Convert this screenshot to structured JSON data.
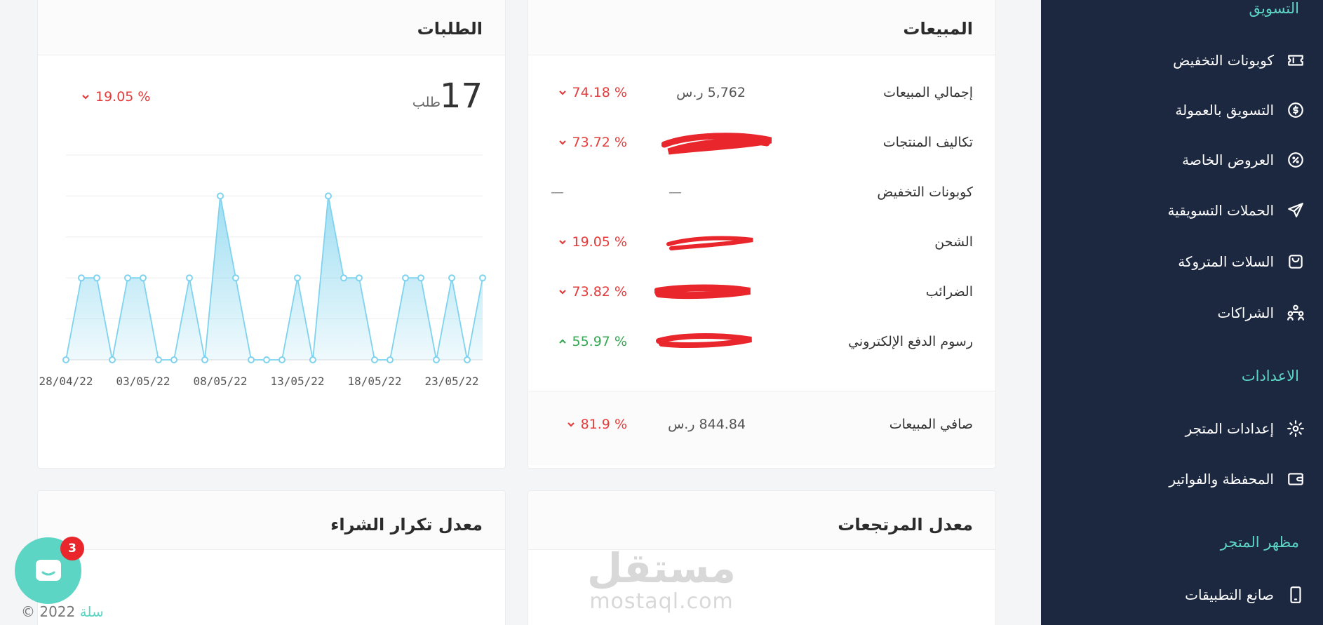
{
  "sidebar": {
    "section_marketing": "التسويق",
    "section_settings": "الاعدادات",
    "section_store_look": "مظهر المتجر",
    "items": [
      {
        "label": "كوبونات التخفيض",
        "icon": "ticket-icon"
      },
      {
        "label": "التسويق بالعمولة",
        "icon": "dollar-coin-icon"
      },
      {
        "label": "العروض الخاصة",
        "icon": "percent-badge-icon"
      },
      {
        "label": "الحملات التسويقية",
        "icon": "send-icon"
      },
      {
        "label": "السلات المتروكة",
        "icon": "basket-icon"
      },
      {
        "label": "الشراكات",
        "icon": "partners-icon"
      },
      {
        "label": "إعدادات المتجر",
        "icon": "gear-icon"
      },
      {
        "label": "المحفظة والفواتير",
        "icon": "wallet-icon"
      },
      {
        "label": "صانع التطبيقات",
        "icon": "phone-icon"
      }
    ]
  },
  "sales": {
    "title": "المبيعات",
    "rows": [
      {
        "label": "إجمالي المبيعات",
        "value": "5,762 ر.س",
        "pct": "74.18 %",
        "dir": "down"
      },
      {
        "label": "تكاليف المنتجات",
        "value": "",
        "pct": "73.72 %",
        "dir": "down"
      },
      {
        "label": "كوبونات التخفيض",
        "value": "—",
        "pct": "—",
        "dir": "none"
      },
      {
        "label": "الشحن",
        "value": "",
        "pct": "19.05 %",
        "dir": "down"
      },
      {
        "label": "الضرائب",
        "value": "",
        "pct": "73.82 %",
        "dir": "down"
      },
      {
        "label": "رسوم الدفع الإلكتروني",
        "value": "",
        "pct": "55.97 %",
        "dir": "up"
      }
    ],
    "net_label": "صافي المبيعات",
    "net_value": "844.84 ر.س",
    "net_pct": "81.9 %"
  },
  "orders": {
    "title": "الطلبات",
    "count": "17",
    "unit": "طلب",
    "pct": "19.05 %"
  },
  "returns": {
    "title": "معدل المرتجعات"
  },
  "repeat": {
    "title": "معدل تكرار الشراء"
  },
  "chat": {
    "badge": "3"
  },
  "footer": {
    "brand": "سلة",
    "copyright": "© 2022"
  },
  "watermark": {
    "ar": "مستقل",
    "en": "mostaql.com"
  },
  "colors": {
    "sidebar_bg": "#1c2740",
    "accent": "#5dd5c4",
    "down": "#e43b3b",
    "up": "#34a853",
    "chart_line": "#7fd3ee"
  },
  "chart_data": {
    "type": "area",
    "x": [
      "28/04/22",
      "29/04/22",
      "30/04/22",
      "01/05/22",
      "02/05/22",
      "03/05/22",
      "04/05/22",
      "05/05/22",
      "06/05/22",
      "07/05/22",
      "08/05/22",
      "09/05/22",
      "10/05/22",
      "11/05/22",
      "12/05/22",
      "13/05/22",
      "14/05/22",
      "15/05/22",
      "16/05/22",
      "17/05/22",
      "18/05/22",
      "19/05/22",
      "20/05/22",
      "21/05/22",
      "22/05/22",
      "23/05/22",
      "24/05/22",
      "25/05/22"
    ],
    "values": [
      0,
      1,
      1,
      0,
      1,
      1,
      0,
      0,
      1,
      0,
      2,
      1,
      0,
      0,
      0,
      1,
      0,
      2,
      1,
      1,
      0,
      0,
      1,
      1,
      0,
      1,
      0,
      1
    ],
    "tick_labels": [
      "28/04/22",
      "03/05/22",
      "08/05/22",
      "13/05/22",
      "18/05/22",
      "23/05/22"
    ],
    "ylim": [
      0,
      2.5
    ],
    "grid": true
  }
}
